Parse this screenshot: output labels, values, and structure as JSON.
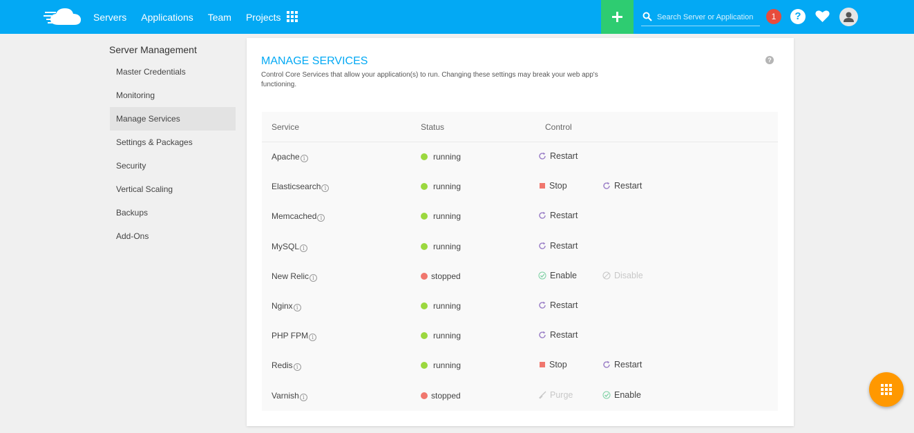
{
  "colors": {
    "topbar": "#03a9f4",
    "plus": "#2ecc71",
    "notif": "#e74c3c",
    "running": "#9bd83f",
    "stopped": "#f0776e",
    "fab": "#ff9800"
  },
  "nav": {
    "servers": "Servers",
    "applications": "Applications",
    "team": "Team",
    "projects": "Projects"
  },
  "search": {
    "placeholder": "Search Server or Application"
  },
  "notifications": {
    "count": "1"
  },
  "sidebar": {
    "title": "Server Management",
    "items": [
      {
        "label": "Master Credentials"
      },
      {
        "label": "Monitoring"
      },
      {
        "label": "Manage Services",
        "active": true
      },
      {
        "label": "Settings & Packages"
      },
      {
        "label": "Security"
      },
      {
        "label": "Vertical Scaling"
      },
      {
        "label": "Backups"
      },
      {
        "label": "Add-Ons"
      }
    ]
  },
  "card": {
    "title": "MANAGE SERVICES",
    "description": "Control Core Services that allow your application(s) to run. Changing these settings may break your web app's functioning.",
    "help": "?"
  },
  "table": {
    "headers": {
      "service": "Service",
      "status": "Status",
      "control": "Control"
    },
    "rows": [
      {
        "name": "Apache",
        "status": "running",
        "controls": [
          {
            "label": "Restart",
            "icon": "restart-icon"
          }
        ]
      },
      {
        "name": "Elasticsearch",
        "status": "running",
        "controls": [
          {
            "label": "Stop",
            "icon": "stop-icon"
          },
          {
            "label": "Restart",
            "icon": "restart-icon"
          }
        ]
      },
      {
        "name": "Memcached",
        "status": "running",
        "controls": [
          {
            "label": "Restart",
            "icon": "restart-icon"
          }
        ]
      },
      {
        "name": "MySQL",
        "status": "running",
        "controls": [
          {
            "label": "Restart",
            "icon": "restart-icon"
          }
        ]
      },
      {
        "name": "New Relic",
        "status": "stopped",
        "controls": [
          {
            "label": "Enable",
            "icon": "enable-icon"
          },
          {
            "label": "Disable",
            "icon": "disable-icon",
            "disabled": true
          }
        ]
      },
      {
        "name": "Nginx",
        "status": "running",
        "controls": [
          {
            "label": "Restart",
            "icon": "restart-icon"
          }
        ]
      },
      {
        "name": "PHP FPM",
        "status": "running",
        "controls": [
          {
            "label": "Restart",
            "icon": "restart-icon"
          }
        ]
      },
      {
        "name": "Redis",
        "status": "running",
        "controls": [
          {
            "label": "Stop",
            "icon": "stop-icon"
          },
          {
            "label": "Restart",
            "icon": "restart-icon"
          }
        ]
      },
      {
        "name": "Varnish",
        "status": "stopped",
        "controls": [
          {
            "label": "Purge",
            "icon": "purge-icon",
            "disabled": true
          },
          {
            "label": "Enable",
            "icon": "enable-icon"
          }
        ]
      }
    ]
  }
}
